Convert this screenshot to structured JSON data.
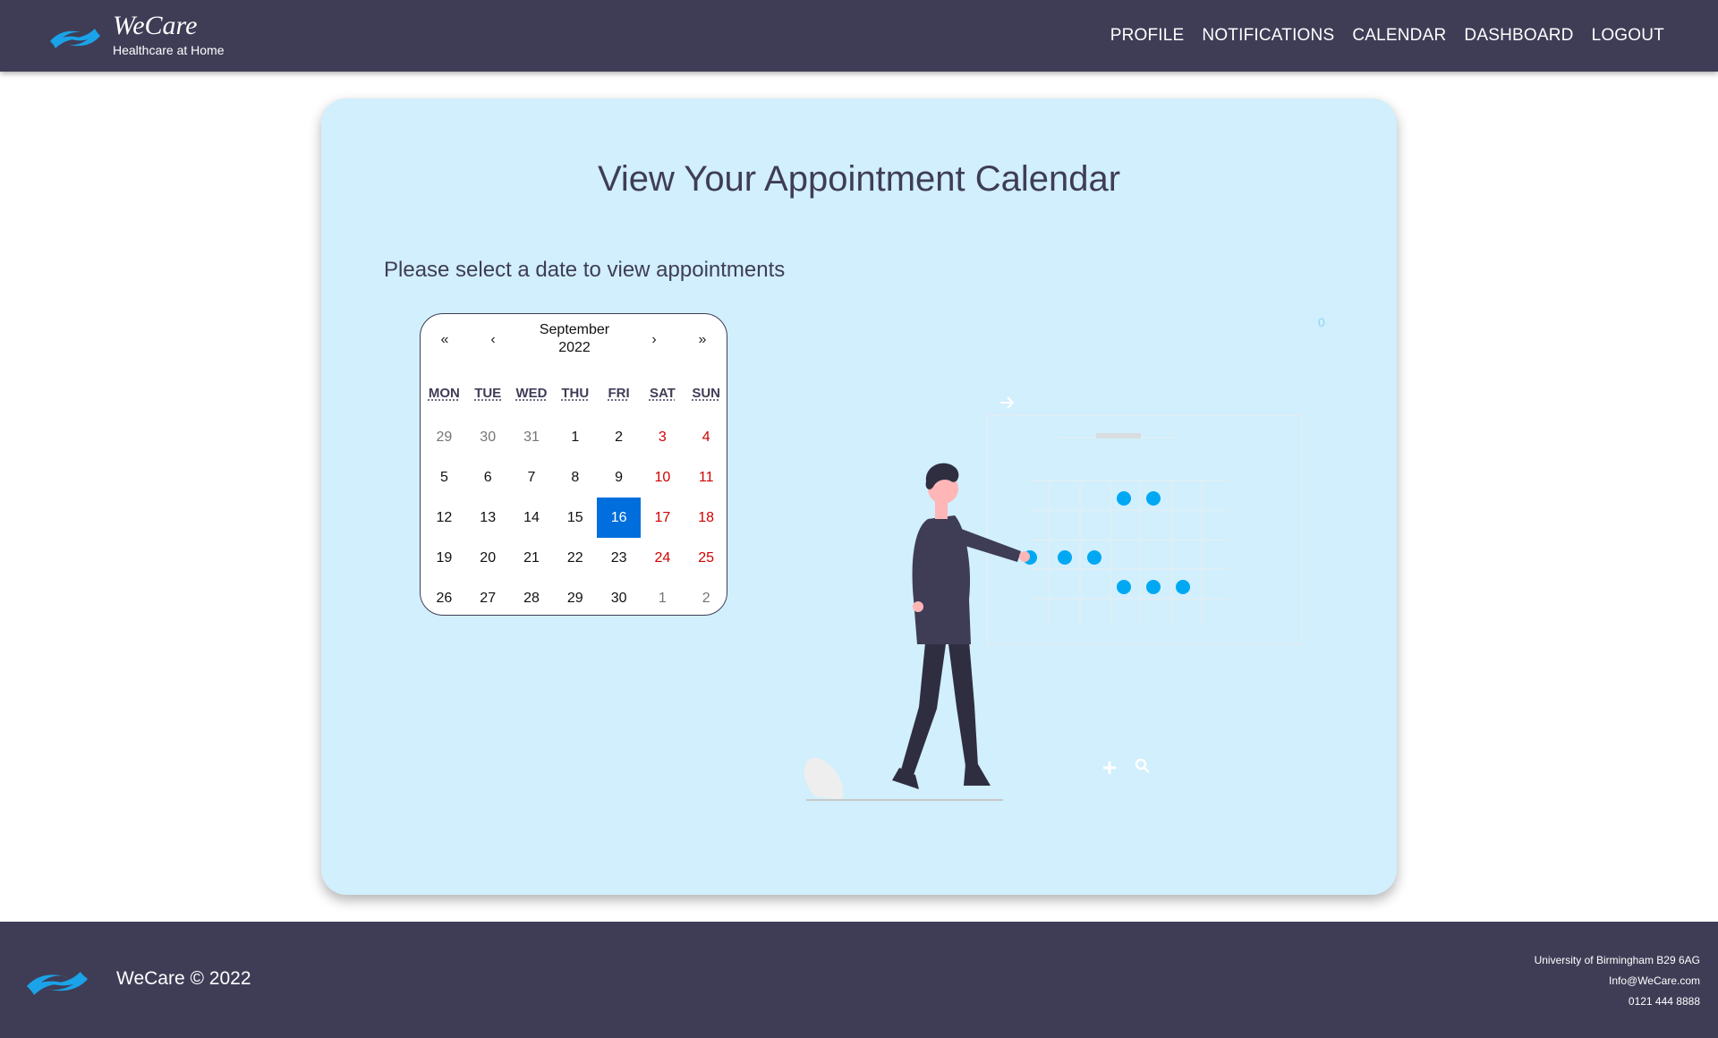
{
  "header": {
    "brand_name": "WeCare",
    "tagline": "Healthcare at Home",
    "nav": [
      "PROFILE",
      "NOTIFICATIONS",
      "CALENDAR",
      "DASHBOARD",
      "LOGOUT"
    ]
  },
  "main": {
    "title": "View Your Appointment Calendar",
    "subtitle": "Please select a date to view appointments",
    "stray_text": "0"
  },
  "calendar": {
    "nav": {
      "prev_year": "«",
      "prev_month": "‹",
      "next_month": "›",
      "next_year": "»"
    },
    "month": "September",
    "year": "2022",
    "weekdays": [
      "MON",
      "TUE",
      "WED",
      "THU",
      "FRI",
      "SAT",
      "SUN"
    ],
    "weeks": [
      [
        "29",
        "30",
        "31",
        "1",
        "2",
        "3",
        "4"
      ],
      [
        "5",
        "6",
        "7",
        "8",
        "9",
        "10",
        "11"
      ],
      [
        "12",
        "13",
        "14",
        "15",
        "16",
        "17",
        "18"
      ],
      [
        "19",
        "20",
        "21",
        "22",
        "23",
        "24",
        "25"
      ],
      [
        "26",
        "27",
        "28",
        "29",
        "30",
        "1",
        "2"
      ]
    ],
    "selected_date": "16"
  },
  "footer": {
    "copyright": "WeCare © 2022",
    "address": "University of Birmingham B29 6AG",
    "email": "Info@WeCare.com",
    "phone": "0121 444 8888"
  },
  "colors": {
    "header_bg": "#3f3d56",
    "card_bg": "#d1effc",
    "accent": "#00a8f3",
    "selected_day": "#006edc",
    "weekend": "#d10000"
  }
}
